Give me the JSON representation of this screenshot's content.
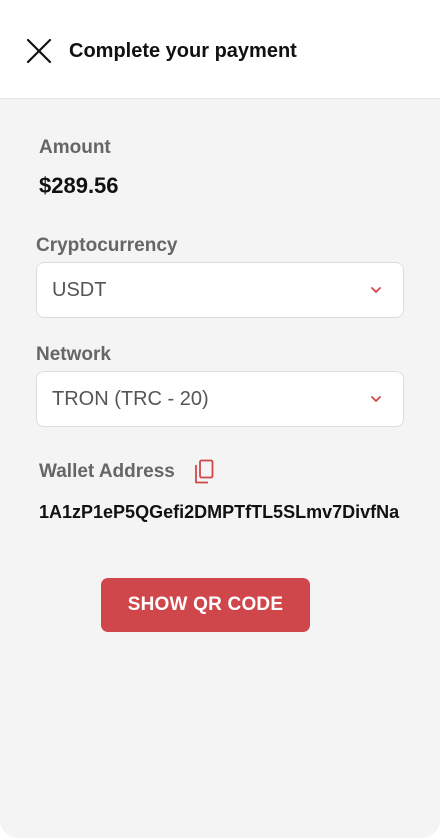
{
  "header": {
    "title": "Complete your payment",
    "close_icon": "close-icon"
  },
  "amount": {
    "label": "Amount",
    "value": "$289.56"
  },
  "cryptocurrency": {
    "label": "Cryptocurrency",
    "selected": "USDT"
  },
  "network": {
    "label": "Network",
    "selected": "TRON (TRC - 20)"
  },
  "wallet": {
    "label": "Wallet Address",
    "address": "1A1zP1eP5QGefi2DMPTfTL5SLmv7DivfNa",
    "copy_icon": "copy-icon"
  },
  "actions": {
    "show_qr_label": "SHOW QR CODE"
  },
  "colors": {
    "accent": "#d0474b",
    "label": "#666666",
    "background": "#f4f4f4"
  }
}
